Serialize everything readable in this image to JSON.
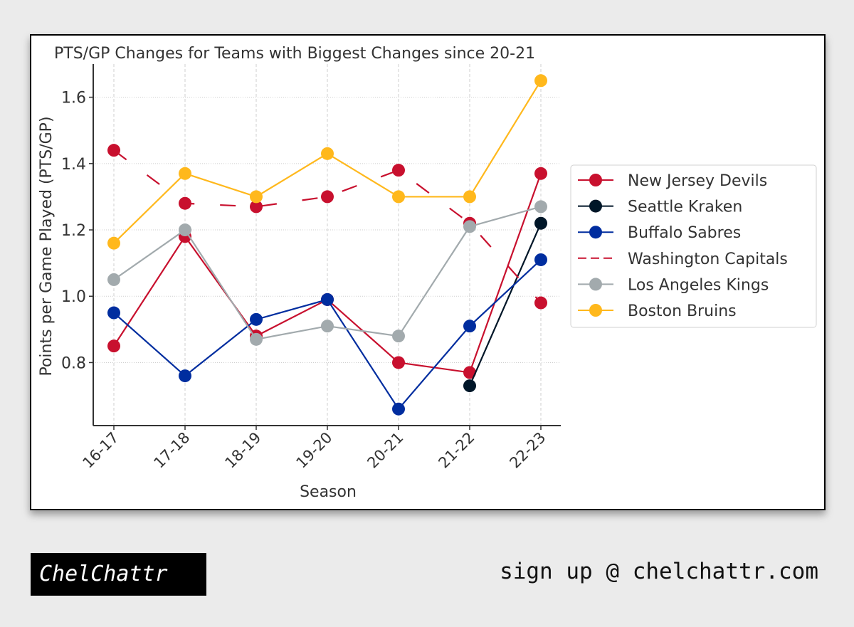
{
  "chart_data": {
    "type": "line",
    "title": "PTS/GP Changes for Teams with Biggest Changes since 20-21",
    "xlabel": "Season",
    "ylabel": "Points per Game Played (PTS/GP)",
    "categories": [
      "16-17",
      "17-18",
      "18-19",
      "19-20",
      "20-21",
      "21-22",
      "22-23"
    ],
    "ylim": [
      0.61,
      1.7
    ],
    "yticks": [
      0.8,
      1.0,
      1.2,
      1.4,
      1.6
    ],
    "ytick_labels": [
      "0.8",
      "1.0",
      "1.2",
      "1.4",
      "1.6"
    ],
    "grid": true,
    "legend_position": "right",
    "series": [
      {
        "name": "New Jersey Devils",
        "color": "#C8102E",
        "style": "solid",
        "values": [
          0.85,
          1.18,
          0.88,
          0.99,
          0.8,
          0.77,
          1.37
        ]
      },
      {
        "name": "Seattle Kraken",
        "color": "#001628",
        "style": "solid",
        "values": [
          null,
          null,
          null,
          null,
          null,
          0.73,
          1.22
        ]
      },
      {
        "name": "Buffalo Sabres",
        "color": "#002D9F",
        "style": "solid",
        "values": [
          0.95,
          0.76,
          0.93,
          0.99,
          0.66,
          0.91,
          1.11
        ]
      },
      {
        "name": "Washington Capitals",
        "color": "#C8102E",
        "style": "dashed",
        "values": [
          1.44,
          1.28,
          1.27,
          1.3,
          1.38,
          1.22,
          0.98
        ]
      },
      {
        "name": "Los Angeles Kings",
        "color": "#A2AAAD",
        "style": "solid",
        "values": [
          1.05,
          1.2,
          0.87,
          0.91,
          0.88,
          1.21,
          1.27
        ]
      },
      {
        "name": "Boston Bruins",
        "color": "#FFB81C",
        "style": "solid",
        "values": [
          1.16,
          1.37,
          1.3,
          1.43,
          1.3,
          1.3,
          1.65
        ]
      }
    ]
  },
  "footer": {
    "brand": "ChelChattr",
    "signup": "sign up @ chelchattr.com"
  }
}
